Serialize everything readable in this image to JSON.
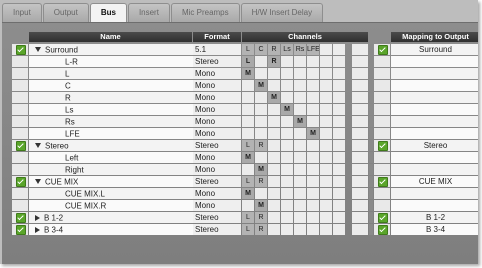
{
  "tabs": [
    {
      "label": "Input",
      "active": false
    },
    {
      "label": "Output",
      "active": false
    },
    {
      "label": "Bus",
      "active": true
    },
    {
      "label": "Insert",
      "active": false
    },
    {
      "label": "Mic Preamps",
      "active": false
    },
    {
      "label": "H/W Insert Delay",
      "active": false
    }
  ],
  "headers": {
    "name": "Name",
    "format": "Format",
    "channels": "Channels",
    "mapping": "Mapping to Output"
  },
  "rows": [
    {
      "type": "parent",
      "checked": true,
      "expanded": true,
      "name": "Surround",
      "format": "5.1",
      "ch": [
        {
          "t": "L",
          "s": "on"
        },
        {
          "t": "C",
          "s": "on"
        },
        {
          "t": "R",
          "s": "on"
        },
        {
          "t": "Ls",
          "s": "on"
        },
        {
          "t": "Rs",
          "s": "on"
        },
        {
          "t": "LFE",
          "s": "on"
        }
      ],
      "map_checked": true,
      "mapping": "Surround"
    },
    {
      "type": "child",
      "name": "L-R",
      "format": "Stereo",
      "ch": [
        {
          "t": "L",
          "s": "mark"
        },
        {
          "t": "",
          "s": ""
        },
        {
          "t": "R",
          "s": "mark"
        },
        {
          "t": "",
          "s": ""
        },
        {
          "t": "",
          "s": ""
        },
        {
          "t": "",
          "s": ""
        }
      ]
    },
    {
      "type": "child",
      "name": "L",
      "format": "Mono",
      "ch": [
        {
          "t": "M",
          "s": "mark"
        },
        {
          "t": "",
          "s": ""
        },
        {
          "t": "",
          "s": ""
        },
        {
          "t": "",
          "s": ""
        },
        {
          "t": "",
          "s": ""
        },
        {
          "t": "",
          "s": ""
        }
      ]
    },
    {
      "type": "child",
      "name": "C",
      "format": "Mono",
      "ch": [
        {
          "t": "",
          "s": ""
        },
        {
          "t": "M",
          "s": "mark"
        },
        {
          "t": "",
          "s": ""
        },
        {
          "t": "",
          "s": ""
        },
        {
          "t": "",
          "s": ""
        },
        {
          "t": "",
          "s": ""
        }
      ]
    },
    {
      "type": "child",
      "name": "R",
      "format": "Mono",
      "ch": [
        {
          "t": "",
          "s": ""
        },
        {
          "t": "",
          "s": ""
        },
        {
          "t": "M",
          "s": "mark"
        },
        {
          "t": "",
          "s": ""
        },
        {
          "t": "",
          "s": ""
        },
        {
          "t": "",
          "s": ""
        }
      ]
    },
    {
      "type": "child",
      "name": "Ls",
      "format": "Mono",
      "ch": [
        {
          "t": "",
          "s": ""
        },
        {
          "t": "",
          "s": ""
        },
        {
          "t": "",
          "s": ""
        },
        {
          "t": "M",
          "s": "mark"
        },
        {
          "t": "",
          "s": ""
        },
        {
          "t": "",
          "s": ""
        }
      ]
    },
    {
      "type": "child",
      "name": "Rs",
      "format": "Mono",
      "ch": [
        {
          "t": "",
          "s": ""
        },
        {
          "t": "",
          "s": ""
        },
        {
          "t": "",
          "s": ""
        },
        {
          "t": "",
          "s": ""
        },
        {
          "t": "M",
          "s": "mark"
        },
        {
          "t": "",
          "s": ""
        }
      ]
    },
    {
      "type": "child",
      "name": "LFE",
      "format": "Mono",
      "ch": [
        {
          "t": "",
          "s": ""
        },
        {
          "t": "",
          "s": ""
        },
        {
          "t": "",
          "s": ""
        },
        {
          "t": "",
          "s": ""
        },
        {
          "t": "",
          "s": ""
        },
        {
          "t": "M",
          "s": "mark"
        }
      ]
    },
    {
      "type": "parent",
      "checked": true,
      "expanded": true,
      "name": "Stereo",
      "format": "Stereo",
      "ch": [
        {
          "t": "L",
          "s": "on"
        },
        {
          "t": "R",
          "s": "on"
        },
        {
          "t": "",
          "s": ""
        },
        {
          "t": "",
          "s": ""
        },
        {
          "t": "",
          "s": ""
        },
        {
          "t": "",
          "s": ""
        }
      ],
      "map_checked": true,
      "mapping": "Stereo"
    },
    {
      "type": "child",
      "name": "Left",
      "format": "Mono",
      "ch": [
        {
          "t": "M",
          "s": "mark"
        },
        {
          "t": "",
          "s": ""
        },
        {
          "t": "",
          "s": ""
        },
        {
          "t": "",
          "s": ""
        },
        {
          "t": "",
          "s": ""
        },
        {
          "t": "",
          "s": ""
        }
      ]
    },
    {
      "type": "child",
      "name": "Right",
      "format": "Mono",
      "ch": [
        {
          "t": "",
          "s": ""
        },
        {
          "t": "M",
          "s": "mark"
        },
        {
          "t": "",
          "s": ""
        },
        {
          "t": "",
          "s": ""
        },
        {
          "t": "",
          "s": ""
        },
        {
          "t": "",
          "s": ""
        }
      ]
    },
    {
      "type": "parent",
      "checked": true,
      "expanded": true,
      "name": "CUE MIX",
      "format": "Stereo",
      "ch": [
        {
          "t": "L",
          "s": "on"
        },
        {
          "t": "R",
          "s": "on"
        },
        {
          "t": "",
          "s": ""
        },
        {
          "t": "",
          "s": ""
        },
        {
          "t": "",
          "s": ""
        },
        {
          "t": "",
          "s": ""
        }
      ],
      "map_checked": true,
      "mapping": "CUE MIX"
    },
    {
      "type": "child",
      "name": "CUE MIX.L",
      "format": "Mono",
      "ch": [
        {
          "t": "M",
          "s": "mark"
        },
        {
          "t": "",
          "s": ""
        },
        {
          "t": "",
          "s": ""
        },
        {
          "t": "",
          "s": ""
        },
        {
          "t": "",
          "s": ""
        },
        {
          "t": "",
          "s": ""
        }
      ]
    },
    {
      "type": "child",
      "name": "CUE MIX.R",
      "format": "Mono",
      "ch": [
        {
          "t": "",
          "s": ""
        },
        {
          "t": "M",
          "s": "mark"
        },
        {
          "t": "",
          "s": ""
        },
        {
          "t": "",
          "s": ""
        },
        {
          "t": "",
          "s": ""
        },
        {
          "t": "",
          "s": ""
        }
      ]
    },
    {
      "type": "parent",
      "checked": true,
      "expanded": false,
      "name": "B 1-2",
      "format": "Stereo",
      "ch": [
        {
          "t": "L",
          "s": "on"
        },
        {
          "t": "R",
          "s": "on"
        },
        {
          "t": "",
          "s": ""
        },
        {
          "t": "",
          "s": ""
        },
        {
          "t": "",
          "s": ""
        },
        {
          "t": "",
          "s": ""
        }
      ],
      "map_checked": true,
      "mapping": "B 1-2"
    },
    {
      "type": "parent",
      "checked": true,
      "expanded": false,
      "name": "B 3-4",
      "format": "Stereo",
      "ch": [
        {
          "t": "L",
          "s": "on"
        },
        {
          "t": "R",
          "s": "on"
        },
        {
          "t": "",
          "s": ""
        },
        {
          "t": "",
          "s": ""
        },
        {
          "t": "",
          "s": ""
        },
        {
          "t": "",
          "s": ""
        }
      ],
      "map_checked": true,
      "mapping": "B 3-4"
    }
  ]
}
